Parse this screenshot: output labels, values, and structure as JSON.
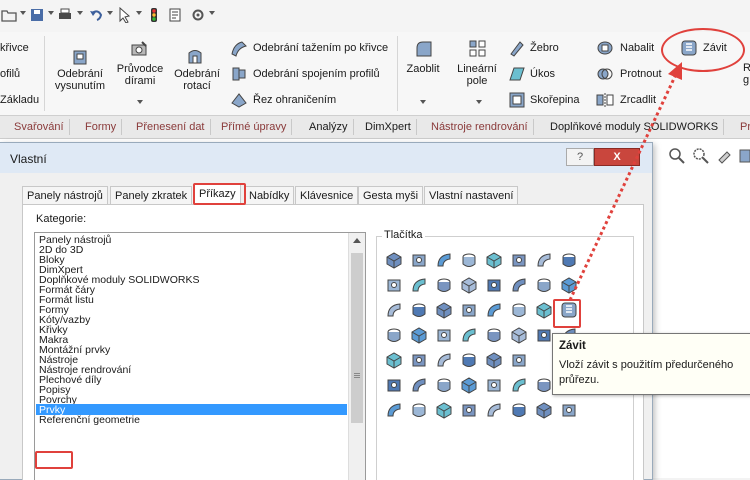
{
  "ribbon": {
    "left_labels": [
      "křivce",
      "ofilů",
      "Základu"
    ],
    "odebrani_vysunutim": [
      "Odebrání",
      "vysunutím"
    ],
    "pruvodce_dirami": [
      "Průvodce",
      "dírami"
    ],
    "odebrani_rotaci": [
      "Odebrání",
      "rotací"
    ],
    "tazenim": "Odebrání tažením po křivce",
    "spojenim": "Odebrání spojením profilů",
    "rez": "Řez ohraničením",
    "zaoblit": "Zaoblit",
    "linearni_pole": [
      "Lineární",
      "pole"
    ],
    "zebro": "Žebro",
    "ukos": "Úkos",
    "skorepina": "Skořepina",
    "nabalit": "Nabalit",
    "protnout": "Protnout",
    "zrcadlit": "Zrcadlit",
    "zavit": "Závit",
    "right_edge": [
      "R",
      "g"
    ]
  },
  "command_tabs": [
    "Svařování",
    "Formy",
    "Přenesení dat",
    "Přímé úpravy",
    "Analýzy",
    "DimXpert",
    "Nástroje rendrování",
    "Doplňkové moduly SOLIDWORKS",
    "Pr"
  ],
  "dialog": {
    "title": "Vlastní",
    "help": "?",
    "close": "X",
    "tabs": [
      "Panely nástrojů",
      "Panely zkratek",
      "Příkazy",
      "Nabídky",
      "Klávesnice",
      "Gesta myši",
      "Vlastní nastavení"
    ],
    "active_tab": "Příkazy",
    "categories_label": "Kategorie:",
    "categories": [
      "Panely nástrojů",
      "2D do 3D",
      "Bloky",
      "DimXpert",
      "Doplňkové moduly SOLIDWORKS",
      "Formát čáry",
      "Formát listu",
      "Formy",
      "Kóty/vazby",
      "Křivky",
      "Makra",
      "Montážní prvky",
      "Nástroje",
      "Nástroje rendrování",
      "Plechové díly",
      "Popisy",
      "Povrchy",
      "Prvky",
      "Referenční geometrie"
    ],
    "selected_category": "Prvky",
    "buttons_label": "Tlačítka"
  },
  "tooltip": {
    "title": "Závit",
    "text_line1": "Vloží závit s použitím předurčeného",
    "text_line2": "průřezu."
  },
  "colors": {
    "annotation_red": "#e0413c",
    "selection_blue": "#3399ff",
    "dialog_title_bg": "#dfe9f5",
    "close_button": "#c9463d"
  }
}
